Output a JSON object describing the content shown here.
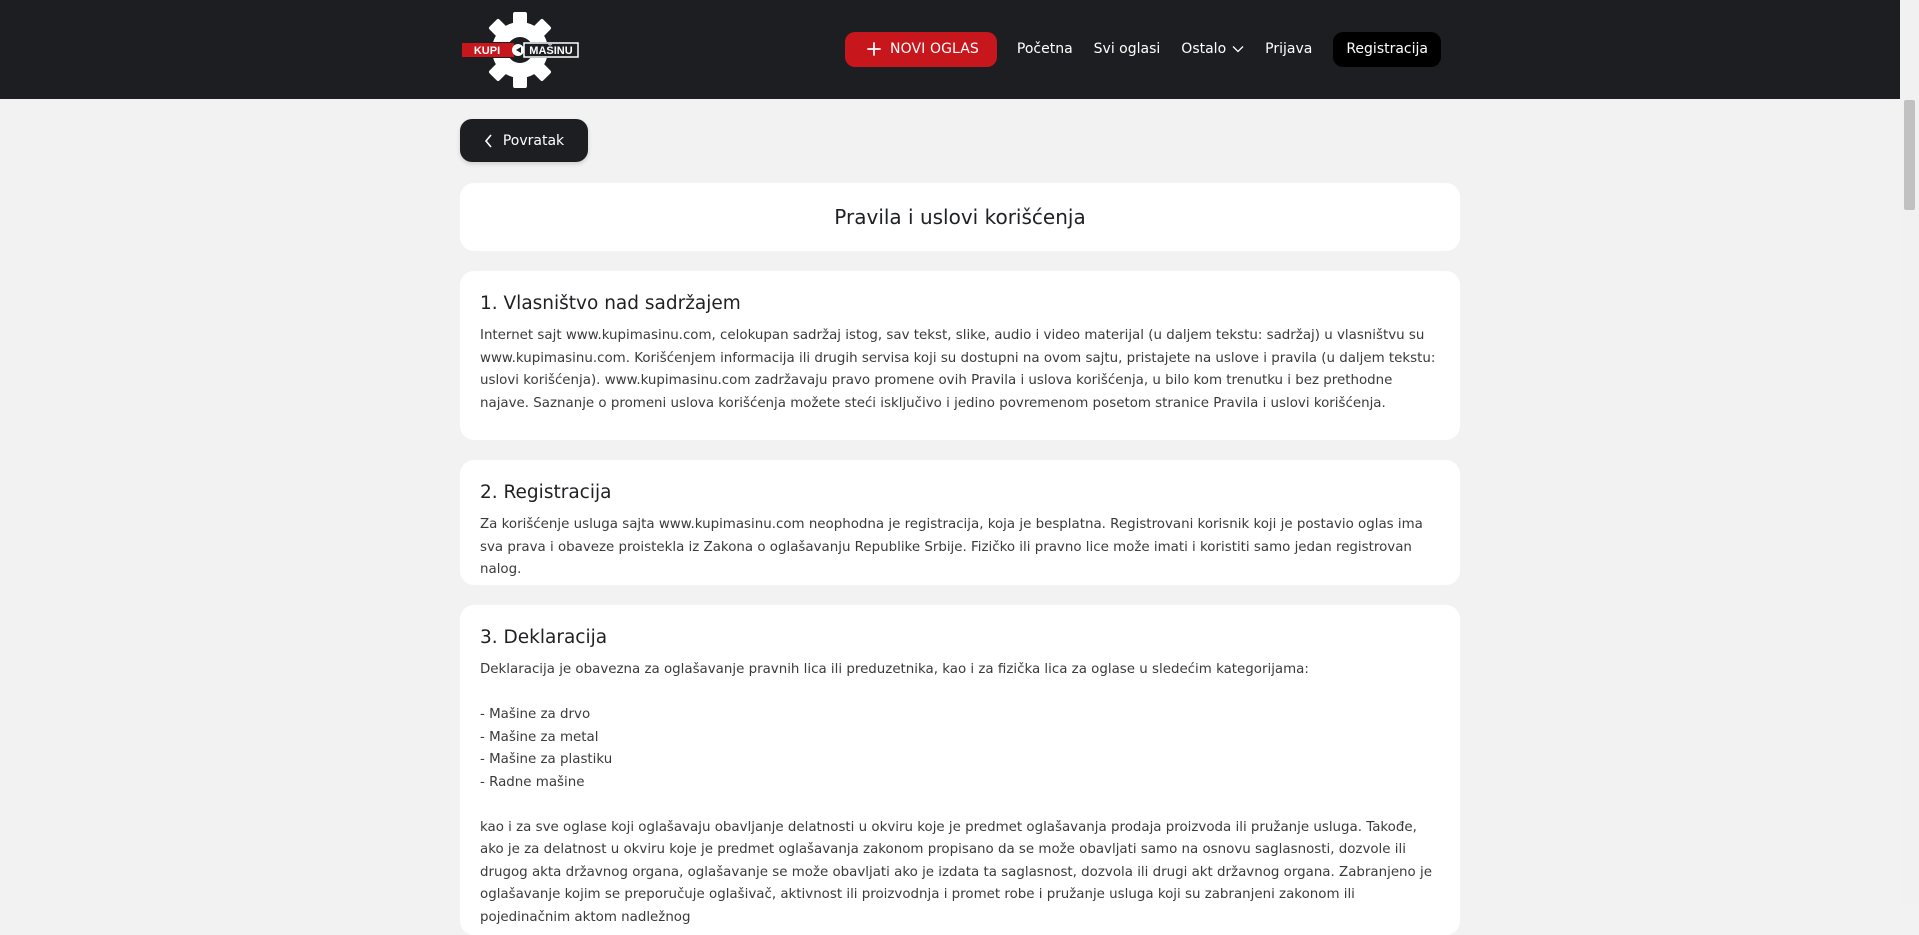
{
  "header": {
    "logo": {
      "text_left": "KUPI",
      "text_right": "MAŠINU",
      "icon": "gear-icon"
    },
    "new_listing_label": "NOVI OGLAS",
    "nav": {
      "home": "Početna",
      "all_listings": "Svi oglasi",
      "other": "Ostalo",
      "login": "Prijava",
      "register": "Registracija"
    },
    "colors": {
      "bar": "#1c1e21",
      "accent": "#c8161d"
    }
  },
  "back_label": "Povratak",
  "page_title": "Pravila i uslovi korišćenja",
  "sections": [
    {
      "heading": "1. Vlasništvo nad sadržajem",
      "body": "Internet sajt www.kupimasinu.com, celokupan sadržaj istog, sav tekst, slike, audio i video materijal (u daljem tekstu: sadržaj) u vlasništvu su www.kupimasinu.com. Korišćenjem informacija ili drugih servisa koji su dostupni na ovom sajtu, pristajete na uslove i pravila (u daljem tekstu: uslovi korišćenja). www.kupimasinu.com zadržavaju pravo promene ovih Pravila i uslova korišćenja, u bilo kom trenutku i bez prethodne najave. Saznanje o promeni uslova korišćenja možete steći isključivo i jedino povremenom posetom stranice Pravila i uslovi korišćenja."
    },
    {
      "heading": "2. Registracija",
      "body": "Za korišćenje usluga sajta www.kupimasinu.com neophodna je registracija, koja je besplatna. Registrovani korisnik koji je postavio oglas ima sva prava i obaveze proistekla iz Zakona o oglašavanju Republike Srbije. Fizičko ili pravno lice može imati i koristiti samo jedan registrovan nalog."
    },
    {
      "heading": "3. Deklaracija",
      "intro": "Deklaracija je obavezna za oglašavanje pravnih lica ili preduzetnika, kao i za fizička lica za oglase u sledećim kategorijama:",
      "items": [
        "- Mašine za drvo",
        "- Mašine za metal",
        "- Mašine za plastiku",
        "- Radne mašine"
      ],
      "body": "kao i za sve oglase koji oglašavaju obavljanje delatnosti u okviru koje je predmet oglašavanja prodaja proizvoda ili pružanje usluga. Takođe, ako je za delatnost u okviru koje je predmet oglašavanja zakonom propisano da se može obavljati samo na osnovu saglasnosti, dozvole ili drugog akta državnog organa, oglašavanje se može obavljati ako je izdata ta saglasnost, dozvola ili drugi akt državnog organa. Zabranjeno je oglašavanje kojim se preporučuje oglašivač, aktivnost ili proizvodnja i promet robe i pružanje usluga koji su zabranjeni zakonom ili pojedinačnim aktom nadležnog"
    }
  ]
}
